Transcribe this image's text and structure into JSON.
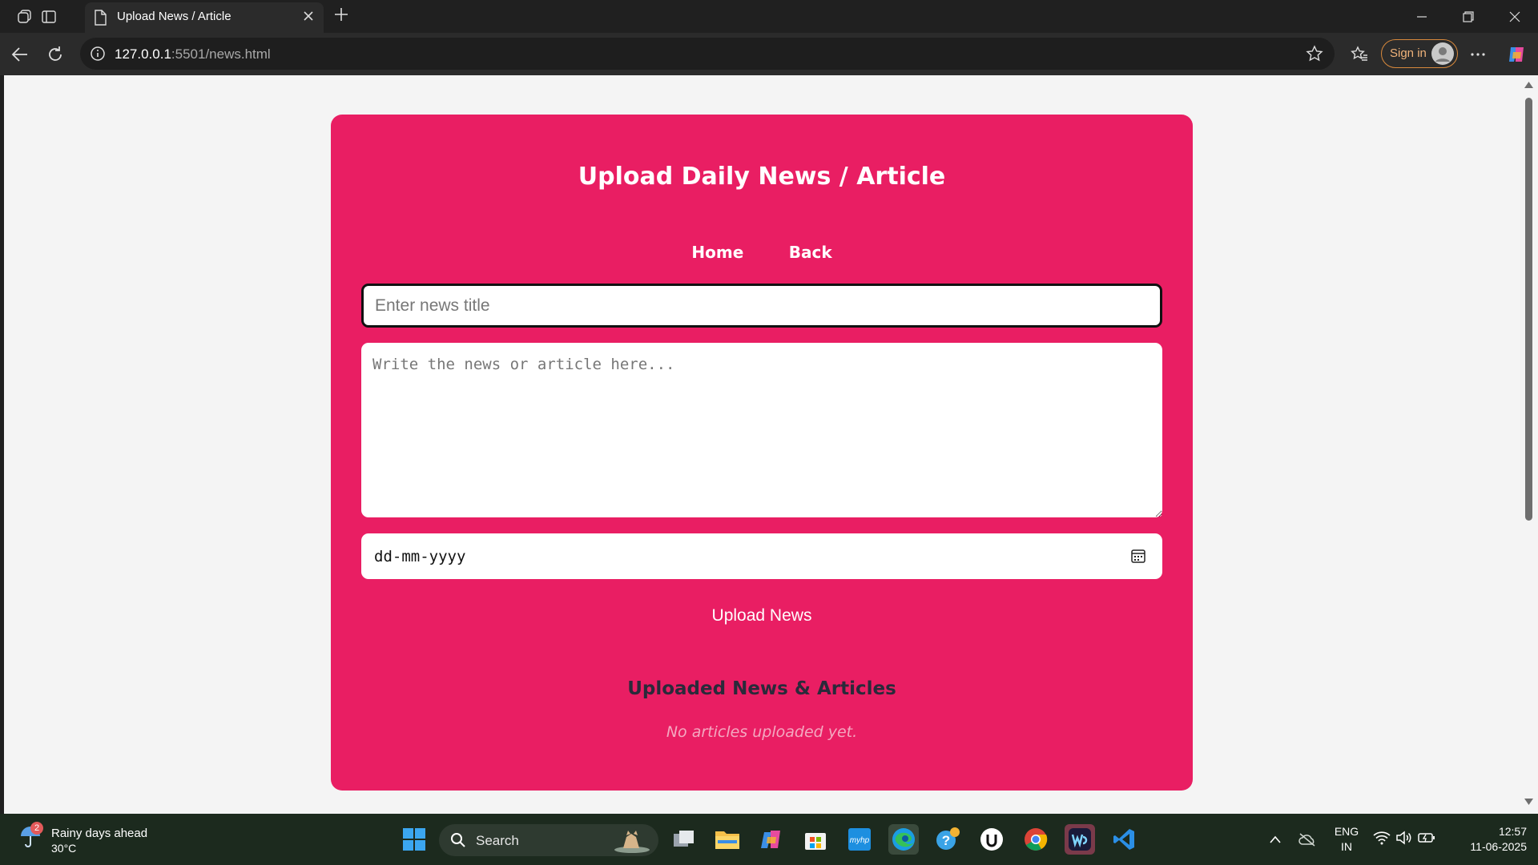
{
  "browser": {
    "tab_title": "Upload News / Article",
    "url_host": "127.0.0.1",
    "url_path": ":5501/news.html",
    "signin_label": "Sign in"
  },
  "page": {
    "title": "Upload Daily News / Article",
    "nav": {
      "home": "Home",
      "back": "Back"
    },
    "title_input": {
      "placeholder": "Enter news title",
      "value": ""
    },
    "body_input": {
      "placeholder": "Write the news or article here...",
      "value": ""
    },
    "date_input": {
      "display": "dd-mm-yyyy"
    },
    "upload_button": "Upload News",
    "section_title": "Uploaded News & Articles",
    "empty_message": "No articles uploaded yet."
  },
  "taskbar": {
    "weather": {
      "badge": "2",
      "summary": "Rainy days ahead",
      "temp": "30°C"
    },
    "search_label": "Search",
    "language": {
      "line1": "ENG",
      "line2": "IN"
    },
    "clock": {
      "time": "12:57",
      "date": "11-06-2025"
    }
  },
  "colors": {
    "card_background": "#e91e63",
    "page_background": "#f4f4f4",
    "section_title": "#2a2a3a",
    "empty_message": "#f4a8c0"
  }
}
